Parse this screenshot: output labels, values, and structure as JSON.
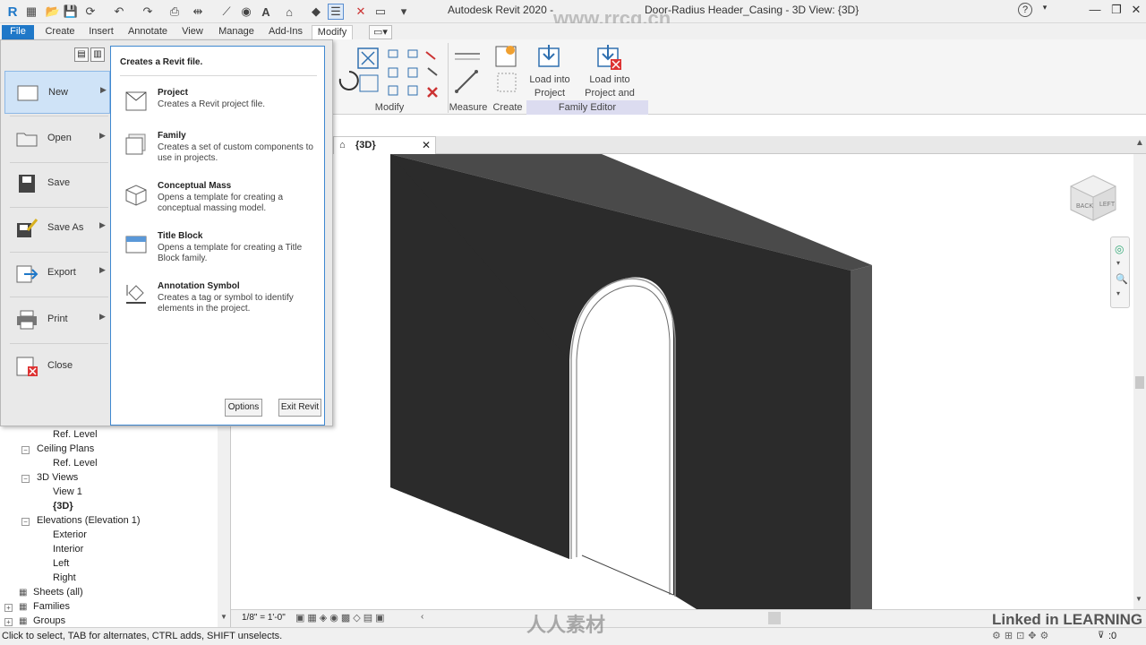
{
  "titlebar": {
    "app_title": "Autodesk Revit 2020 -",
    "doc_title": "Door-Radius Header_Casing - 3D View: {3D}",
    "watermark": "www.rrcg.cn",
    "help_icon": "?"
  },
  "ribbon_tabs": [
    {
      "label": "File"
    },
    {
      "label": "Create"
    },
    {
      "label": "Insert"
    },
    {
      "label": "Annotate"
    },
    {
      "label": "View"
    },
    {
      "label": "Manage"
    },
    {
      "label": "Add-Ins"
    },
    {
      "label": "Modify"
    }
  ],
  "ribbon": {
    "modify_panel": "Modify",
    "measure_panel": "Measure",
    "create_panel": "Create",
    "family_editor_panel": "Family Editor",
    "load_into_project": "Load into\nProject",
    "load_into_project_close": "Load into\nProject and Close"
  },
  "app_menu": {
    "items": [
      {
        "label": "New",
        "has_arrow": true,
        "icon": "new-file-icon"
      },
      {
        "label": "Open",
        "has_arrow": true,
        "icon": "open-folder-icon"
      },
      {
        "label": "Save",
        "has_arrow": false,
        "icon": "save-disk-icon"
      },
      {
        "label": "Save As",
        "has_arrow": true,
        "icon": "save-as-icon"
      },
      {
        "label": "Export",
        "has_arrow": true,
        "icon": "export-icon"
      },
      {
        "label": "Print",
        "has_arrow": true,
        "icon": "printer-icon"
      },
      {
        "label": "Close",
        "has_arrow": false,
        "icon": "close-file-icon"
      }
    ],
    "submenu_header": "Creates a Revit file.",
    "submenu": [
      {
        "title": "Project",
        "desc": "Creates a Revit project file."
      },
      {
        "title": "Family",
        "desc": "Creates a set of custom components to use in projects."
      },
      {
        "title": "Conceptual Mass",
        "desc": "Opens a template for creating a conceptual massing model."
      },
      {
        "title": "Title Block",
        "desc": "Opens a template for creating a Title Block family."
      },
      {
        "title": "Annotation Symbol",
        "desc": "Creates a tag or symbol to identify elements in the project."
      }
    ],
    "options_label": "Options",
    "exit_label": "Exit Revit"
  },
  "view_tab": {
    "label": "{3D}"
  },
  "project_browser": {
    "items": [
      {
        "label": "Ref. Level"
      },
      {
        "label": "Ceiling Plans"
      },
      {
        "label": "Ref. Level"
      },
      {
        "label": "3D Views"
      },
      {
        "label": "View 1"
      },
      {
        "label": "{3D}"
      },
      {
        "label": "Elevations (Elevation 1)"
      },
      {
        "label": "Exterior"
      },
      {
        "label": "Interior"
      },
      {
        "label": "Left"
      },
      {
        "label": "Right"
      },
      {
        "label": "Sheets (all)"
      },
      {
        "label": "Families"
      },
      {
        "label": "Groups"
      }
    ]
  },
  "view_control_bar": {
    "scale": "1/8\" = 1'-0\""
  },
  "status_bar": {
    "hint": "Click to select, TAB for alternates, CTRL adds, SHIFT unselects.",
    "filter_count": ":0"
  },
  "viewcube": {
    "face1": "BACK",
    "face2": "LEFT"
  },
  "branding": {
    "watermark_cn": "人人素材",
    "linkedin": "Linked in LEARNING"
  },
  "colors": {
    "file_tab": "#1f78c8",
    "wall": "#2b2b2b",
    "selected_item": "#cfe3f7"
  }
}
